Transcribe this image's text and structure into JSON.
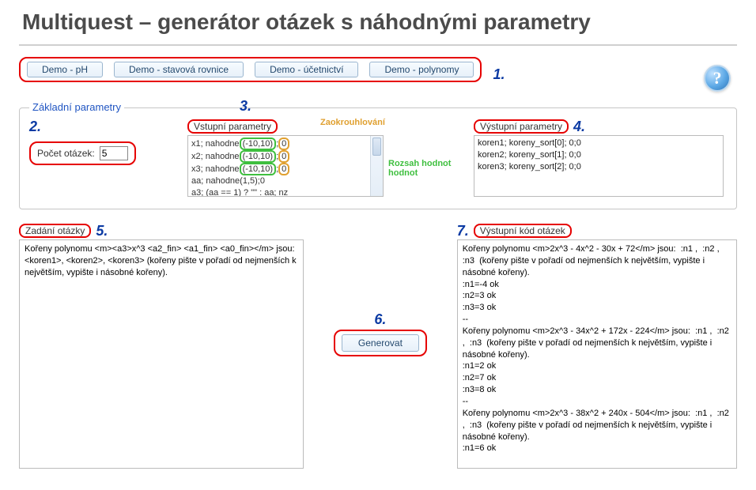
{
  "title": "Multiquest – generátor otázek s náhodnými parametry",
  "steps": {
    "s1": "1.",
    "s2": "2.",
    "s3": "3.",
    "s4": "4.",
    "s5": "5.",
    "s6": "6.",
    "s7": "7."
  },
  "demos": {
    "ph": "Demo - pH",
    "stav": "Demo - stavová rovnice",
    "ucet": "Demo - účetnictví",
    "poly": "Demo - polynomy"
  },
  "basic": {
    "legend": "Základní parametry",
    "count_label": "Počet otázek:",
    "count_value": "5"
  },
  "input_params": {
    "label": "Vstupní parametry",
    "annot_round": "Zaokrouhlování",
    "annot_range": "Rozsah hodnot",
    "lines": [
      {
        "pre": "x1; nahodne",
        "hl": "(-10,10)",
        "post1": ";",
        "round": "0"
      },
      {
        "pre": "x2; nahodne",
        "hl": "(-10,10)",
        "post1": ";",
        "round": "0"
      },
      {
        "pre": "x3; nahodne",
        "hl": "(-10,10)",
        "post1": ";",
        "round": "0"
      },
      {
        "raw": "aa;  nahodne(1,5);0"
      },
      {
        "raw": "a3; (aa == 1) ? \"\" : aa; nz"
      }
    ]
  },
  "output_params": {
    "label": "Výstupní parametry",
    "text": "koren1; koreny_sort[0]; 0;0\nkoren2; koreny_sort[1]; 0;0\nkoren3; koreny_sort[2]; 0;0"
  },
  "question": {
    "label": "Zadání otázky",
    "text": "Kořeny polynomu <m><a3>x^3 <a2_fin> <a1_fin> <a0_fin></m> jsou: <koren1>, <koren2>, <koren3> (kořeny pište v pořadí od nejmenších k největším, vypište i násobné kořeny)."
  },
  "generate": {
    "label": "Generovat"
  },
  "output_code": {
    "label": "Výstupní kód otázek",
    "text": "Kořeny polynomu <m>2x^3 - 4x^2 - 30x + 72</m> jsou:  :n1 ,  :n2 ,  :n3  (kořeny pište v pořadí od nejmenších k největším, vypište i násobné kořeny).\n:n1=-4 ok\n:n2=3 ok\n:n3=3 ok\n--\nKořeny polynomu <m>2x^3 - 34x^2 + 172x - 224</m> jsou:  :n1 ,  :n2 ,  :n3  (kořeny pište v pořadí od nejmenších k největším, vypište i násobné kořeny).\n:n1=2 ok\n:n2=7 ok\n:n3=8 ok\n--\nKořeny polynomu <m>2x^3 - 38x^2 + 240x - 504</m> jsou:  :n1 ,  :n2 ,  :n3  (kořeny pište v pořadí od nejmenších k největším, vypište i násobné kořeny).\n:n1=6 ok"
  }
}
